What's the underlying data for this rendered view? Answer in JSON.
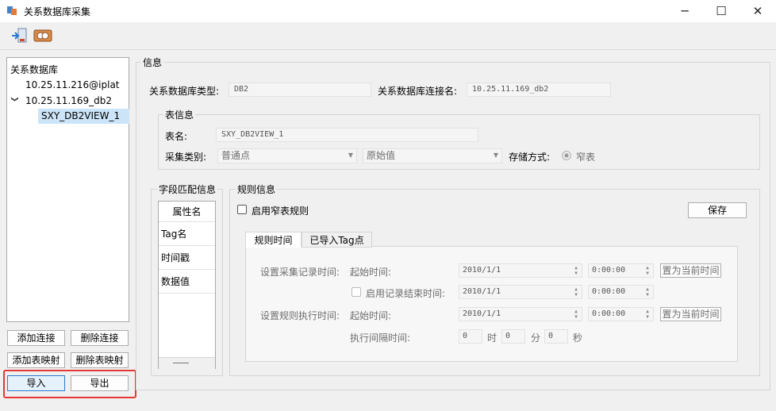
{
  "window": {
    "title": "关系数据库采集",
    "minimize": "─",
    "maximize": "☐",
    "close": "✕"
  },
  "tree": {
    "root": "关系数据库",
    "items": [
      {
        "label": "10.25.11.216@iplat",
        "expanded": false
      },
      {
        "label": "10.25.11.169_db2",
        "expanded": true,
        "children": [
          "SXY_DB2VIEW_1"
        ]
      }
    ],
    "expand_glyph": "❯"
  },
  "left_buttons": {
    "add_connection": "添加连接",
    "delete_connection": "删除连接",
    "add_table_mapping": "添加表映射",
    "delete_table_mapping": "删除表映射",
    "import": "导入",
    "export": "导出"
  },
  "info": {
    "group_title": "信息",
    "db_type_label": "关系数据库类型:",
    "db_type_value": "DB2",
    "conn_name_label": "关系数据库连接名:",
    "conn_name_value": "10.25.11.169_db2",
    "table_info": {
      "group_title": "表信息",
      "table_name_label": "表名:",
      "table_name_value": "SXY_DB2VIEW_1",
      "collect_type_label": "采集类别:",
      "collect_type_value": "普通点",
      "value_type_value": "原始值",
      "storage_label": "存储方式:",
      "storage_value": "窄表"
    }
  },
  "field_match": {
    "group_title": "字段匹配信息",
    "header": "属性名",
    "rows": [
      "Tag名",
      "时间戳",
      "数据值"
    ]
  },
  "rule": {
    "group_title": "规则信息",
    "enable_narrow_label": "启用窄表规则",
    "save_label": "保存",
    "tabs": [
      "规则时间",
      "已导入Tag点"
    ],
    "collect_time_label": "设置采集记录时间:",
    "start_time_label": "起始时间:",
    "start_date": "2010/1/1",
    "start_time": "0:00:00",
    "set_now_label": "置为当前时间",
    "enable_end_label": "启用记录结束时间:",
    "end_date": "2010/1/1",
    "end_time": "0:00:00",
    "exec_time_label": "设置规则执行时间:",
    "exec_start_label": "起始时间:",
    "exec_date": "2010/1/1",
    "exec_time": "0:00:00",
    "exec_set_now_label": "置为当前时间",
    "interval_label": "执行间隔时间:",
    "interval_hours": "0",
    "hours_unit": "时",
    "interval_minutes": "0",
    "minutes_unit": "分",
    "interval_seconds": "0",
    "seconds_unit": "秒"
  }
}
